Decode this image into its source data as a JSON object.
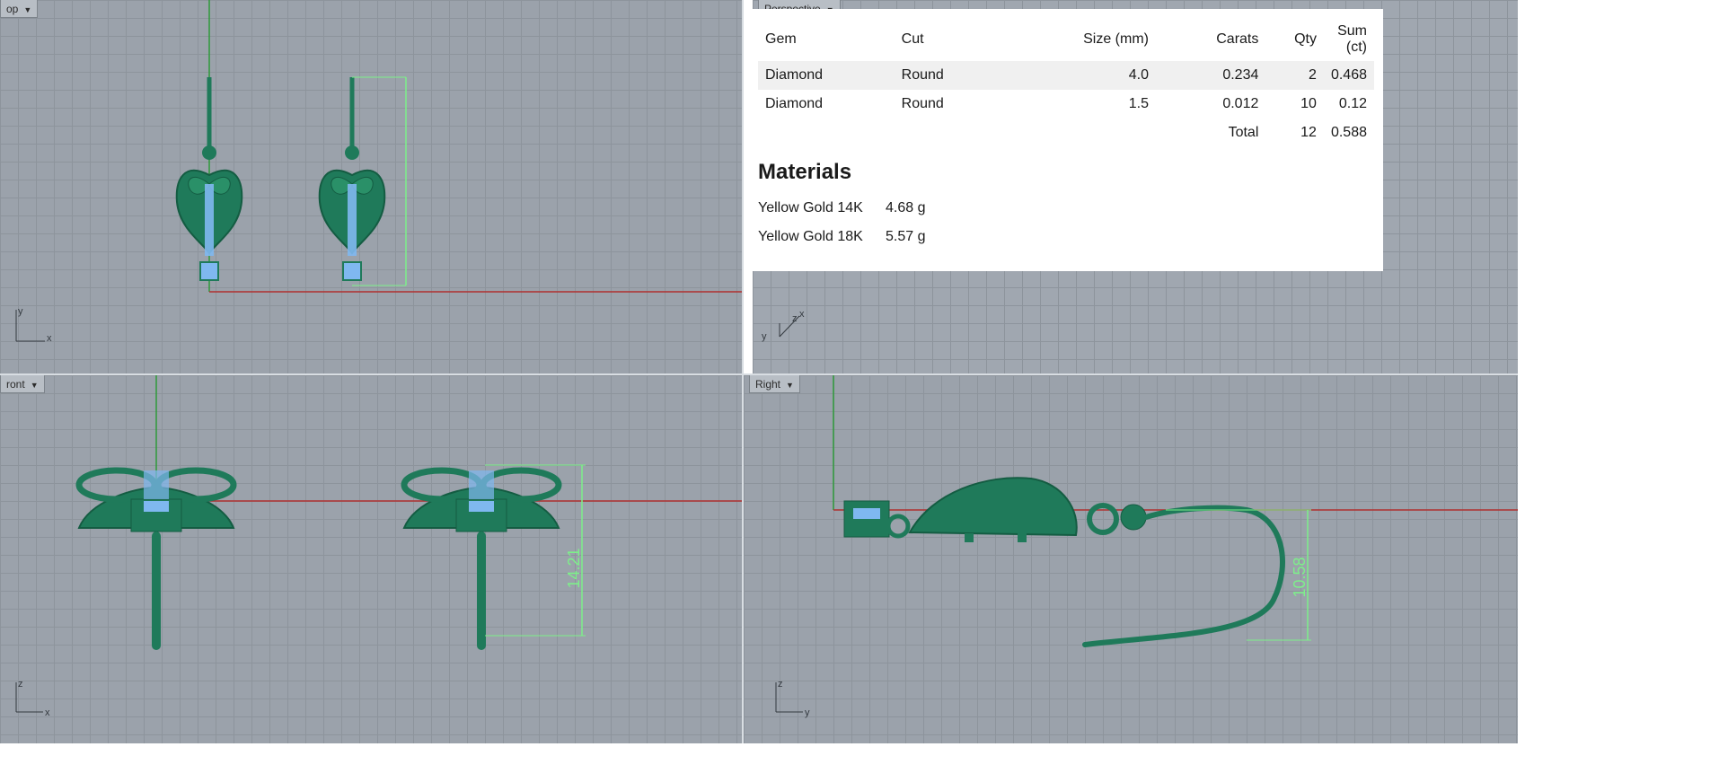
{
  "viewports": {
    "top": {
      "label": "op",
      "axes": [
        "y",
        "x"
      ]
    },
    "perspective": {
      "label": "Perspective",
      "axes": [
        "y",
        "z",
        "x"
      ]
    },
    "front": {
      "label": "ront",
      "axes": [
        "z",
        "x"
      ],
      "dimension": "14.21"
    },
    "right": {
      "label": "Right",
      "axes": [
        "z",
        "y"
      ],
      "dimension": "10.58"
    }
  },
  "report": {
    "columns": [
      "Gem",
      "Cut",
      "Size (mm)",
      "Carats",
      "Qty",
      "Sum (ct)"
    ],
    "rows": [
      {
        "gem": "Diamond",
        "cut": "Round",
        "size": "4.0",
        "carats": "0.234",
        "qty": "2",
        "sum": "0.468"
      },
      {
        "gem": "Diamond",
        "cut": "Round",
        "size": "1.5",
        "carats": "0.012",
        "qty": "10",
        "sum": "0.12"
      }
    ],
    "total": {
      "label": "Total",
      "qty": "12",
      "sum": "0.588"
    },
    "materials_title": "Materials",
    "materials": [
      {
        "name": "Yellow Gold 14K",
        "weight": "4.68 g"
      },
      {
        "name": "Yellow Gold 18K",
        "weight": "5.57 g"
      }
    ]
  },
  "colors": {
    "background": "#9ba2ab",
    "grid": "#8d949c",
    "model": "#1f7a5a",
    "gem": "#7fb8f0",
    "dimension": "#7df08a",
    "x_axis": "#b03030",
    "y_axis": "#2e9a3a"
  }
}
